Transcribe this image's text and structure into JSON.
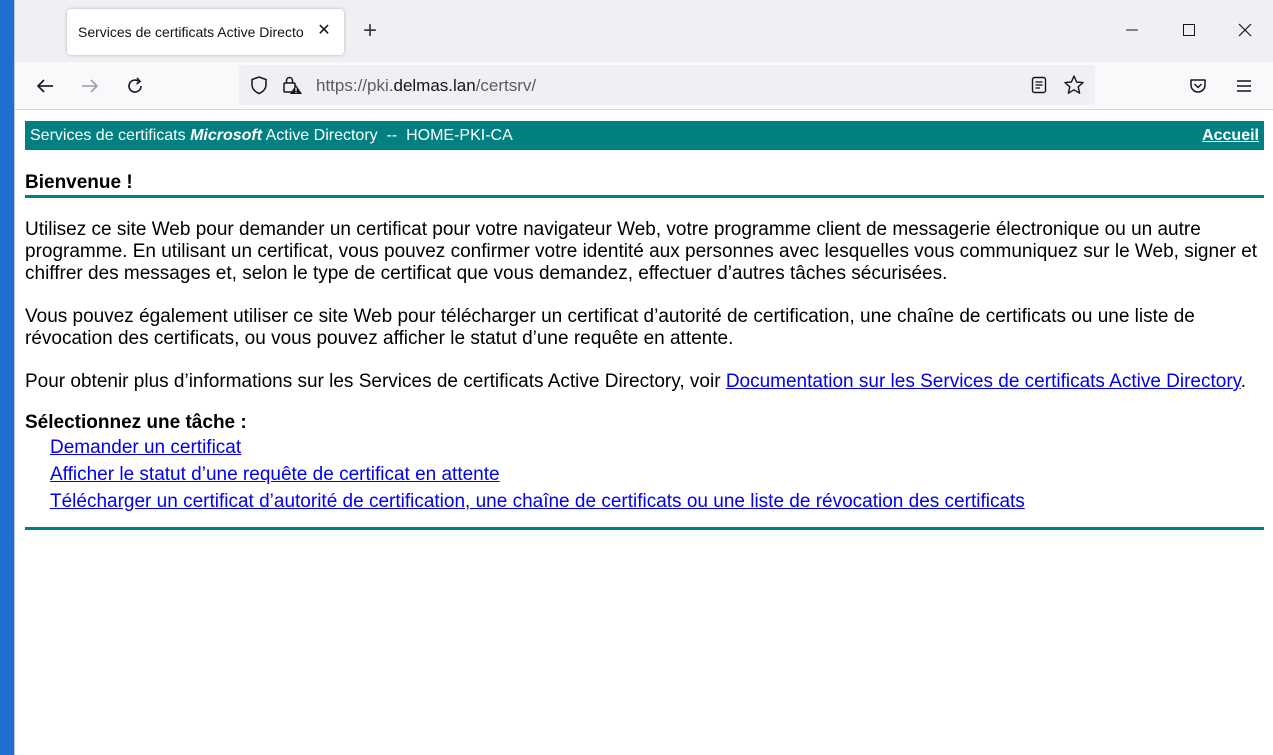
{
  "browser": {
    "tab_title": "Services de certificats Active Directo",
    "url_prefix": "https://pki.",
    "url_domain": "delmas.lan",
    "url_path": "/certsrv/"
  },
  "page": {
    "header": {
      "prefix": "Services de certificats ",
      "brand": "Microsoft",
      "suffix": " Active Directory  --  HOME-PKI-CA",
      "home_link": "Accueil"
    },
    "welcome": "Bienvenue !",
    "paragraph1": "Utilisez ce site Web pour demander un certificat pour votre navigateur Web, votre programme client de messagerie électronique ou un autre programme. En utilisant un certificat, vous pouvez confirmer votre identité aux personnes avec lesquelles vous communiquez sur le Web, signer et chiffrer des messages et, selon le type de certificat que vous demandez, effectuer d’autres tâches sécurisées.",
    "paragraph2": "Vous pouvez également utiliser ce site Web pour télécharger un certificat d’autorité de certification, une chaîne de certificats ou une liste de révocation des certificats, ou vous pouvez afficher le statut d’une requête en attente.",
    "paragraph3_text": "Pour obtenir plus d’informations sur les Services de certificats Active Directory, voir ",
    "paragraph3_link": "Documentation sur les Services de certificats Active Directory",
    "paragraph3_end": ".",
    "task_heading": "Sélectionnez une tâche :",
    "tasks": [
      "Demander un certificat",
      "Afficher le statut d’une requête de certificat en attente",
      "Télécharger un certificat d’autorité de certification, une chaîne de certificats ou une liste de révocation des certificats"
    ]
  },
  "colors": {
    "accent": "#008080",
    "link": "#0000ee",
    "desktop": "#1e6fd0"
  }
}
